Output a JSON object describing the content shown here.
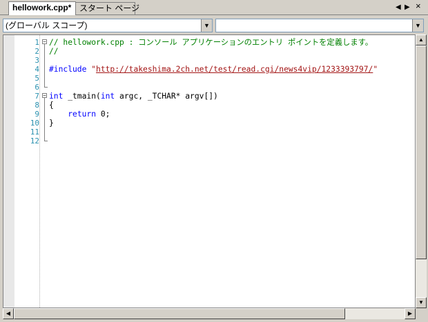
{
  "tabs": [
    {
      "label": "hellowork.cpp*",
      "active": true
    },
    {
      "label": "スタート ページ",
      "active": false
    }
  ],
  "tab_nav": {
    "left_icon": "arrow-left-icon",
    "right_icon": "arrow-right-icon",
    "close_icon": "close-icon",
    "close_glyph": "×",
    "left_glyph": "◀",
    "right_glyph": "▶"
  },
  "scope_combo": {
    "value": "(グローバル スコープ)",
    "arrow_glyph": "▼"
  },
  "member_combo": {
    "value": "",
    "arrow_glyph": "▼"
  },
  "line_numbers": [
    "1",
    "2",
    "3",
    "4",
    "5",
    "6",
    "7",
    "8",
    "9",
    "10",
    "11",
    "12"
  ],
  "code": {
    "l1": "// hellowork.cpp : コンソール アプリケーションのエントリ ポイントを定義します。",
    "l2": "//",
    "l4_directive": "#include ",
    "l4_quote_open": "\"",
    "l4_url": "http://takeshima.2ch.net/test/read.cgi/news4vip/1233393797/",
    "l4_quote_close": "\"",
    "l7_kw1": "int",
    "l7_mid": " _tmain(",
    "l7_kw2": "int",
    "l7_rest": " argc, _TCHAR* argv[])",
    "l8": "{",
    "l9_indent": "    ",
    "l9_kw": "return",
    "l9_rest": " 0;",
    "l10": "}"
  },
  "outline_glyphs": {
    "minus": "−"
  },
  "scroll_glyphs": {
    "up": "▲",
    "down": "▼",
    "left": "◀",
    "right": "▶"
  },
  "colors": {
    "comment": "#008000",
    "keyword": "#0000ff",
    "string": "#a31515",
    "line_number": "#2b91af"
  }
}
